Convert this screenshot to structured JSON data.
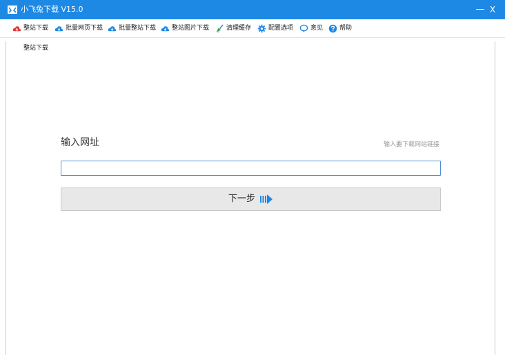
{
  "window": {
    "title": "小飞兔下载 V15.0",
    "minimize_label": "—",
    "close_label": "X",
    "accent_color": "#1e88e5"
  },
  "toolbar": {
    "items": [
      {
        "label": "整站下载",
        "icon": "cloud-download-icon",
        "color": "#e53935"
      },
      {
        "label": "批量网页下载",
        "icon": "cloud-download-icon",
        "color": "#1e88e5"
      },
      {
        "label": "批量整站下载",
        "icon": "cloud-download-icon",
        "color": "#1e88e5"
      },
      {
        "label": "整站图片下载",
        "icon": "cloud-download-icon",
        "color": "#1e88e5"
      },
      {
        "label": "清理缓存",
        "icon": "broom-icon",
        "color": "#1e88e5"
      },
      {
        "label": "配置选项",
        "icon": "gear-icon",
        "color": "#1e88e5"
      },
      {
        "label": "意见",
        "icon": "comment-icon",
        "color": "#1e88e5"
      },
      {
        "label": "帮助",
        "icon": "help-icon",
        "color": "#1e88e5"
      }
    ]
  },
  "tabs": {
    "active_label": "整站下载"
  },
  "main": {
    "url_label": "输入网址",
    "url_hint": "输入要下载网站链接",
    "url_value": "",
    "next_button_label": "下一步"
  }
}
